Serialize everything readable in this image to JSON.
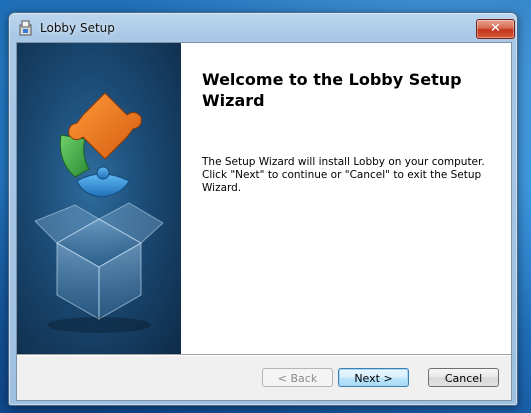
{
  "window": {
    "title": "Lobby Setup",
    "close_label": "✕"
  },
  "wizard": {
    "heading": "Welcome to the Lobby Setup Wizard",
    "description": "The Setup Wizard will install Lobby on your computer.  Click \"Next\" to continue or \"Cancel\" to exit the Setup Wizard."
  },
  "buttons": {
    "back_label": "< Back",
    "next_label": "Next >",
    "cancel_label": "Cancel"
  },
  "icons": {
    "title": "installer-package-icon",
    "banner": "puzzle-box-installer-graphic",
    "close": "close-icon"
  },
  "colors": {
    "banner_dark": "#0f2b48",
    "puzzle_orange": "#e8731e",
    "puzzle_green": "#3fa84a",
    "puzzle_blue": "#2a8fd6",
    "close_red": "#c2341c"
  }
}
